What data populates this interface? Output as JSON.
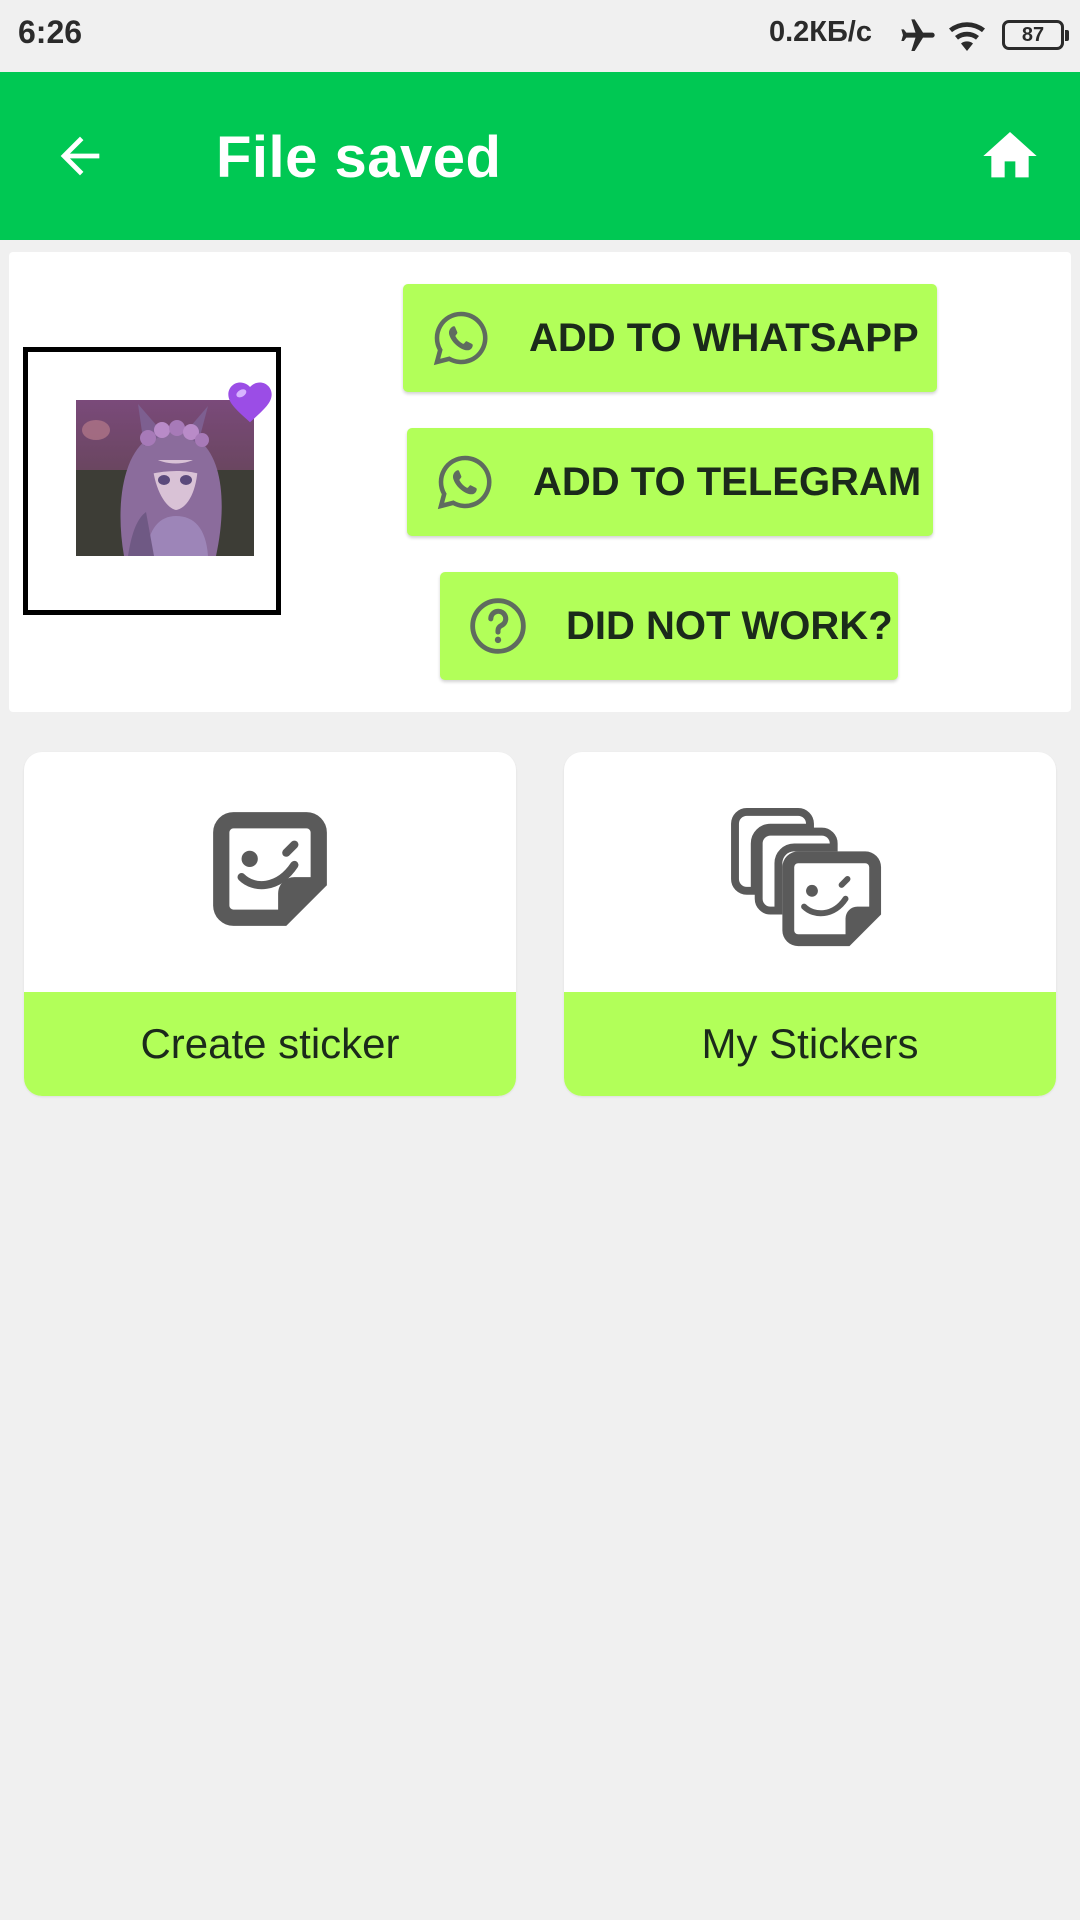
{
  "status_bar": {
    "time": "6:26",
    "net_speed": "0.2КБ/с",
    "battery": "87",
    "icons": [
      "airplane-icon",
      "wifi-icon",
      "battery-icon"
    ]
  },
  "app_bar": {
    "title": "File saved",
    "back_icon": "arrow-back-icon",
    "home_icon": "home-icon",
    "color": "#00c853"
  },
  "actions": {
    "whatsapp_label": "ADD TO WHATSAPP",
    "telegram_label": "ADD TO TELEGRAM",
    "help_label": "DID NOT WORK?",
    "button_color": "#b2ff59"
  },
  "sticker_preview": {
    "image": "anime-girl-sticker",
    "badge": "purple-heart"
  },
  "cards": {
    "create_label": "Create sticker",
    "my_stickers_label": "My Stickers"
  }
}
